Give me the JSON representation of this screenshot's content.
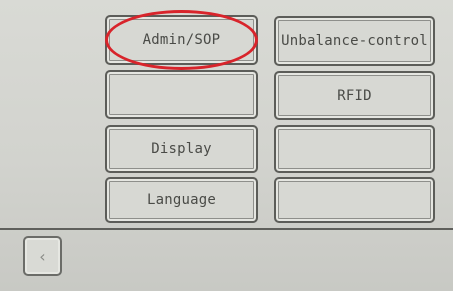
{
  "buttons": {
    "admin_sop": "Admin/SOP",
    "unbalance_control": "Unbalance-control",
    "empty_left_2": "",
    "rfid": "RFID",
    "display": "Display",
    "empty_right_3": "",
    "language": "Language",
    "empty_right_4": ""
  },
  "nav": {
    "back_glyph": "‹"
  },
  "colors": {
    "highlight": "#d8242b",
    "screen_bg": "#d2d3ce",
    "border": "#5c5d59",
    "text": "#4a4b47"
  }
}
